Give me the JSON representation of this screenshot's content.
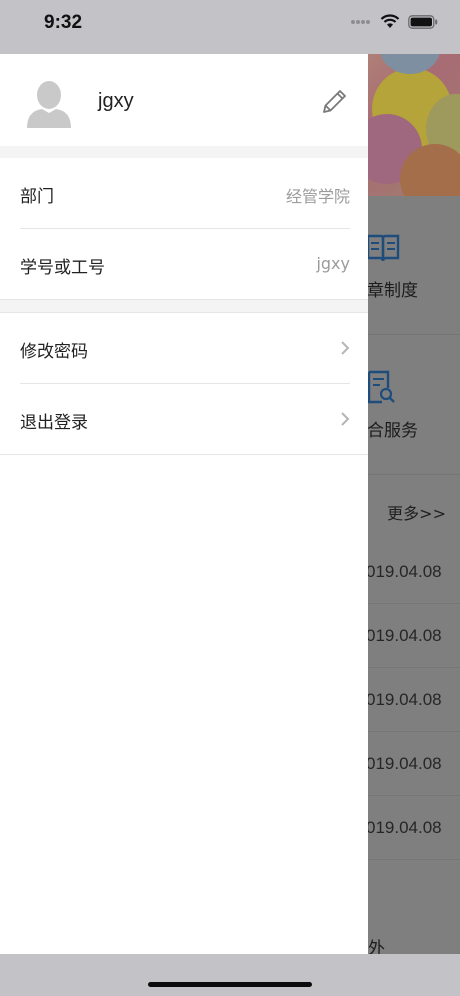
{
  "status_bar": {
    "time": "9:32"
  },
  "drawer": {
    "username": "jgxy",
    "info_rows": [
      {
        "label": "部门",
        "value": "经管学院"
      },
      {
        "label": "学号或工号",
        "value": "jgxy"
      }
    ],
    "action_rows": [
      {
        "label": "修改密码"
      },
      {
        "label": "退出登录"
      }
    ]
  },
  "background": {
    "grid_items": [
      {
        "label": "章制度",
        "icon": "book-icon"
      },
      {
        "label": "合服务",
        "icon": "document-search-icon"
      }
    ],
    "more_link": "更多>>",
    "dates": [
      "019.04.08",
      "019.04.08",
      "019.04.08",
      "019.04.08",
      "019.04.08"
    ],
    "bottom_text": "外"
  },
  "colors": {
    "overlay": "#7f7f80",
    "drawer_bg": "#ffffff",
    "value_gray": "#9b9b9b",
    "icon_blue": "#2a6fb2"
  }
}
